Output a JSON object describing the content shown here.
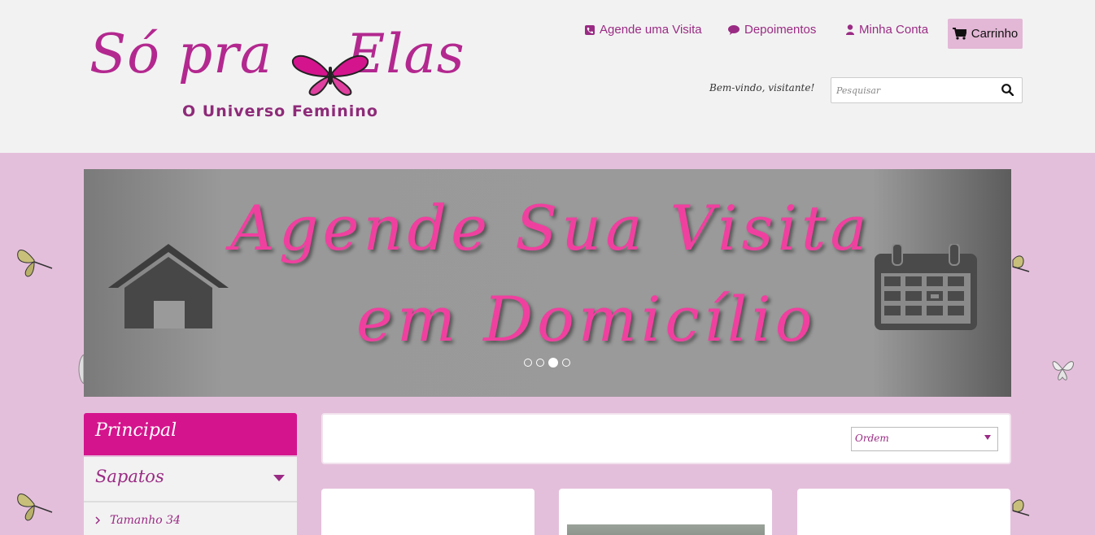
{
  "header": {
    "logo": {
      "word1": "Só",
      "word2": "pra",
      "word3": "Elas",
      "tagline": "O Universo Feminino"
    },
    "nav": {
      "agende": "Agende uma Visita",
      "depoimentos": "Depoimentos",
      "conta": "Minha Conta",
      "carrinho": "Carrinho"
    },
    "welcome": "Bem-vindo, visitante!",
    "search": {
      "placeholder": "Pesquisar"
    }
  },
  "banner": {
    "line1": "Agende Sua Visita",
    "line2": "em Domicílio",
    "slides": 4,
    "active_slide": 3
  },
  "sidebar": {
    "heading": "Principal",
    "category": "Sapatos",
    "sub_item": "Tamanho 34"
  },
  "sort": {
    "selected": "Ordem"
  },
  "colors": {
    "brand_pink": "#d4148d",
    "text_purple": "#9a2b84",
    "background": "#e4bfdb"
  }
}
